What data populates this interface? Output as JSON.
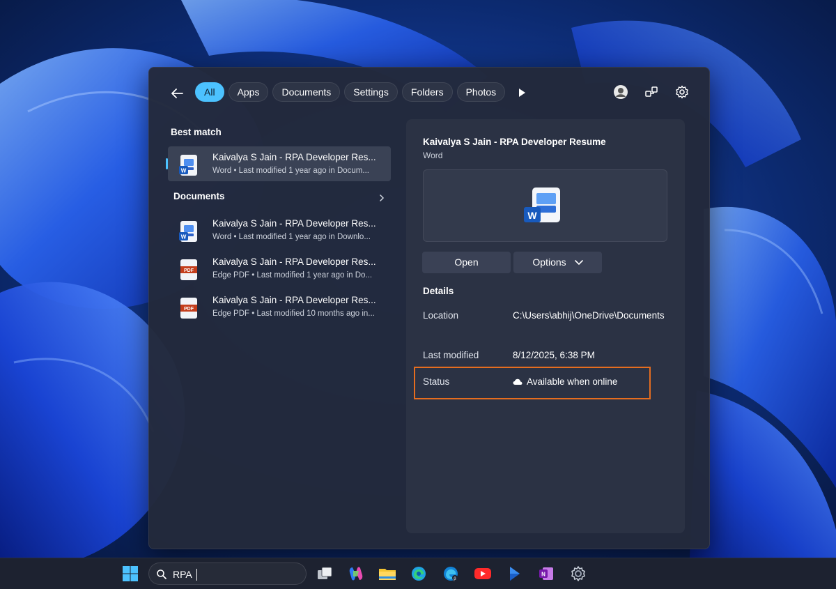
{
  "filters": [
    {
      "label": "All",
      "active": true
    },
    {
      "label": "Apps"
    },
    {
      "label": "Documents"
    },
    {
      "label": "Settings"
    },
    {
      "label": "Folders"
    },
    {
      "label": "Photos"
    }
  ],
  "best_match": {
    "heading": "Best match",
    "item": {
      "title": "Kaivalya S Jain - RPA Developer Res...",
      "subtitle": "Word • Last modified 1 year ago in Docum...",
      "icon": "word-file-icon"
    }
  },
  "documents": {
    "heading": "Documents",
    "items": [
      {
        "title": "Kaivalya S Jain - RPA Developer Res...",
        "subtitle": "Word • Last modified 1 year ago in Downlo...",
        "icon": "word-file-icon"
      },
      {
        "title": "Kaivalya S Jain - RPA Developer Res...",
        "subtitle": "Edge PDF • Last modified 1 year ago in Do...",
        "icon": "pdf-file-icon"
      },
      {
        "title": "Kaivalya S Jain - RPA Developer Res...",
        "subtitle": "Edge PDF • Last modified 10 months ago in...",
        "icon": "pdf-file-icon"
      }
    ]
  },
  "preview": {
    "title": "Kaivalya S Jain - RPA Developer Resume",
    "subtitle": "Word",
    "open_label": "Open",
    "options_label": "Options",
    "details_heading": "Details",
    "location_label": "Location",
    "location_value": "C:\\Users\\abhij\\OneDrive\\Documents",
    "modified_label": "Last modified",
    "modified_value": "8/12/2025, 6:38 PM",
    "status_label": "Status",
    "status_value": "Available when online"
  },
  "taskbar": {
    "search_value": "RPA",
    "apps": [
      "windows-start-icon",
      "task-view-icon",
      "copilot-icon",
      "file-explorer-icon",
      "edge-icon",
      "edge-beta-icon",
      "youtube-icon",
      "media-icon",
      "onenote-icon",
      "settings-icon"
    ]
  },
  "colors": {
    "accent": "#4cc2ff",
    "panel_bg": "#23293b",
    "highlight_box": "#e56d1f",
    "taskbar_bg": "#1d2230"
  }
}
